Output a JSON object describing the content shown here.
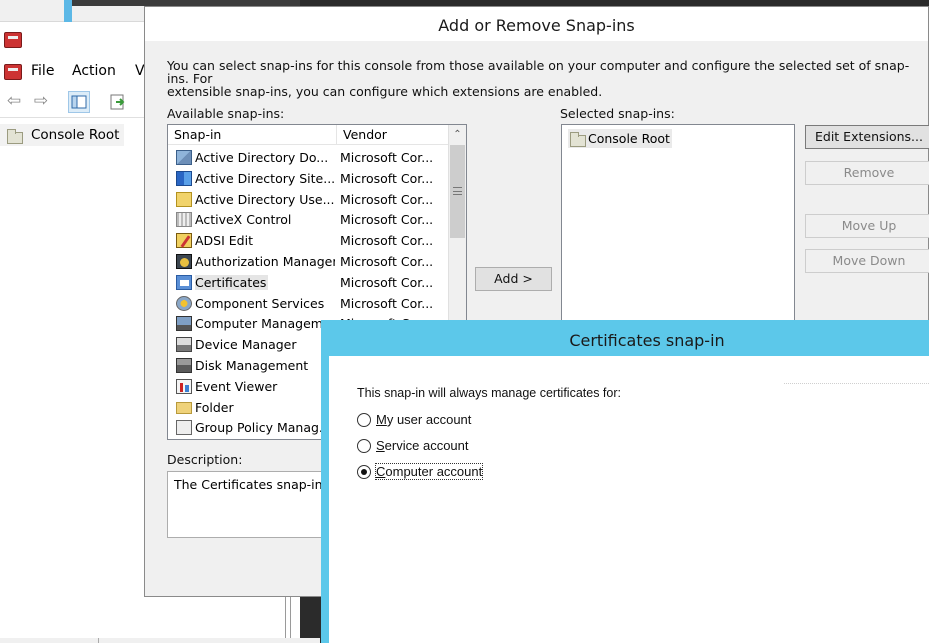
{
  "mmc": {
    "menu": {
      "file": "File",
      "action": "Action",
      "view": "V"
    },
    "tree": {
      "root": "Console Root"
    }
  },
  "snapins_dialog": {
    "title": "Add or Remove Snap-ins",
    "intro_line1": "You can select snap-ins for this console from those available on your computer and configure the selected set of snap-ins. For",
    "intro_line2": "extensible snap-ins, you can configure which extensions are enabled.",
    "available_label": "Available snap-ins:",
    "selected_label": "Selected snap-ins:",
    "columns": {
      "snapin": "Snap-in",
      "vendor": "Vendor"
    },
    "items": [
      {
        "name": "Active Directory Do...",
        "vendor": "Microsoft Cor...",
        "icon": "ad-domains-icon"
      },
      {
        "name": "Active Directory Site...",
        "vendor": "Microsoft Cor...",
        "icon": "ad-sites-icon"
      },
      {
        "name": "Active Directory Use...",
        "vendor": "Microsoft Cor...",
        "icon": "ad-users-icon"
      },
      {
        "name": "ActiveX Control",
        "vendor": "Microsoft Cor...",
        "icon": "activex-icon"
      },
      {
        "name": "ADSI Edit",
        "vendor": "Microsoft Cor...",
        "icon": "adsi-edit-icon"
      },
      {
        "name": "Authorization Manager",
        "vendor": "Microsoft Cor...",
        "icon": "authorization-icon"
      },
      {
        "name": "Certificates",
        "vendor": "Microsoft Cor...",
        "icon": "certificates-icon"
      },
      {
        "name": "Component Services",
        "vendor": "Microsoft Cor...",
        "icon": "component-services-icon"
      },
      {
        "name": "Computer Managem...",
        "vendor": "Microsoft Cor...",
        "icon": "computer-management-icon"
      },
      {
        "name": "Device Manager",
        "vendor": "",
        "icon": "device-manager-icon"
      },
      {
        "name": "Disk Management",
        "vendor": "",
        "icon": "disk-management-icon"
      },
      {
        "name": "Event Viewer",
        "vendor": "",
        "icon": "event-viewer-icon"
      },
      {
        "name": "Folder",
        "vendor": "",
        "icon": "folder-icon"
      },
      {
        "name": "Group Policy Manag...",
        "vendor": "",
        "icon": "group-policy-icon"
      }
    ],
    "selected_items": [
      "Console Root"
    ],
    "add_button": "Add >",
    "edit_extensions_button": "Edit Extensions...",
    "remove_button": "Remove",
    "move_up_button": "Move Up",
    "move_down_button": "Move Down",
    "description_label": "Description:",
    "description_text": "The Certificates snap-in a"
  },
  "cert_dialog": {
    "title": "Certificates snap-in",
    "prompt": "This snap-in will always manage certificates for:",
    "options": [
      {
        "accel": "M",
        "rest": "y user account",
        "checked": false
      },
      {
        "accel": "S",
        "rest": "ervice account",
        "checked": false
      },
      {
        "accel": "C",
        "rest": "omputer account",
        "checked": true
      }
    ]
  },
  "colors": {
    "cert_titlebar": "#5cc8ea",
    "dialog_bg": "#f0f0f0",
    "list_border": "#828790"
  }
}
